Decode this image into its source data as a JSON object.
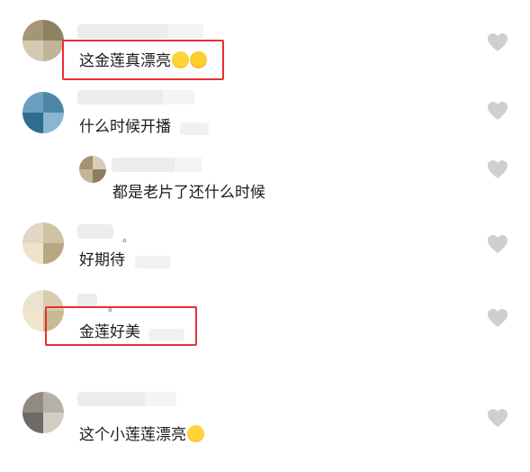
{
  "comments": [
    {
      "text": "这金莲真漂亮",
      "emojis": [
        "grinning-squint-emoji",
        "laughing-emoji"
      ],
      "highlighted": true
    },
    {
      "text": "什么时候开播",
      "highlighted": false
    },
    {
      "text": "都是老片了还什么时候",
      "reply": true,
      "highlighted": false
    },
    {
      "text": "好期待",
      "highlighted": false
    },
    {
      "text": "金莲好美",
      "highlighted": true
    },
    {
      "text": "这个小莲莲漂亮",
      "emojis": [
        "grinning-squint-emoji"
      ],
      "highlighted": false
    }
  ],
  "colors": {
    "highlight_border": "#e8302f",
    "heart_fill": "#cfcfcf",
    "text": "#1c1c1c"
  },
  "icons": {
    "like": "heart-icon"
  }
}
